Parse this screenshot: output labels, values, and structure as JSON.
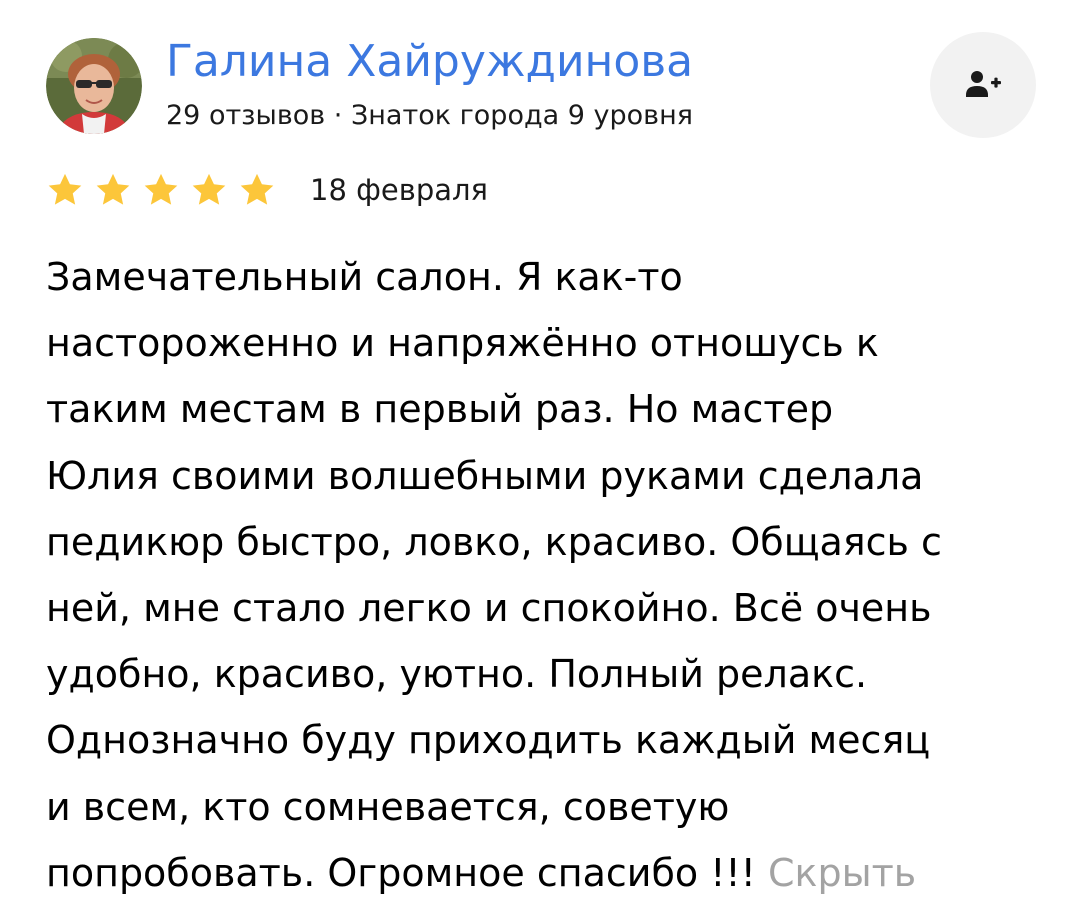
{
  "author": {
    "name": "Галина Хайруждинова",
    "meta": "29 отзывов · Знаток города 9 уровня",
    "avatar_icon": "user-photo-avatar"
  },
  "subscribe_button": {
    "icon": "add-user-icon"
  },
  "rating": {
    "stars": 5,
    "max": 5,
    "color": "#fcc63a",
    "date": "18 февраля"
  },
  "review": {
    "lines": [
      "Замечательный салон. Я как-то",
      "настороженно и напряжённо отношусь к",
      "таким местам в первый раз. Но мастер",
      "Юлия своими волшебными руками сделала",
      "педикюр быстро, ловко, красиво. Общаясь с",
      "ней, мне стало легко и спокойно. Всё очень",
      "удобно, красиво, уютно. Полный релакс.",
      "Однозначно буду приходить каждый месяц",
      "и всем, кто сомневается, советую",
      "попробовать. Огромное спасибо !!!"
    ],
    "hide_label": "Скрыть"
  },
  "colors": {
    "link_blue": "#3c78e0",
    "muted_gray": "#a3a3a3",
    "button_bg": "#f2f2f2"
  }
}
